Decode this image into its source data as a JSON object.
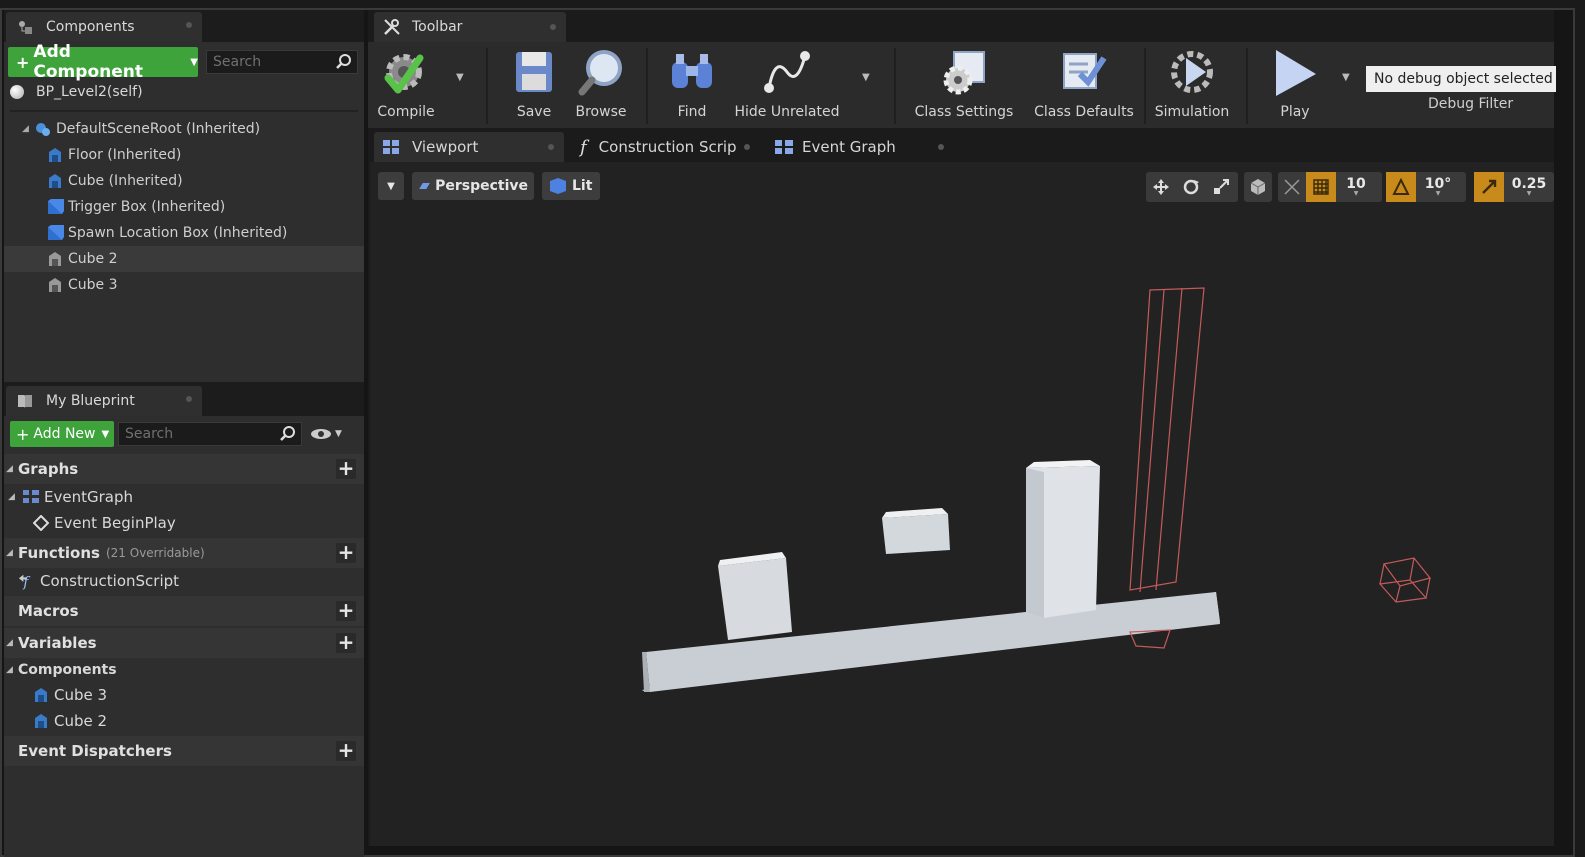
{
  "components_panel": {
    "tab_label": "Components",
    "add_button": "Add Component",
    "search_placeholder": "Search",
    "self_item": "BP_Level2(self)",
    "tree": [
      {
        "label": "DefaultSceneRoot (Inherited)"
      },
      {
        "label": "Floor (Inherited)"
      },
      {
        "label": "Cube (Inherited)"
      },
      {
        "label": "Trigger Box (Inherited)"
      },
      {
        "label": "Spawn Location Box (Inherited)"
      },
      {
        "label": "Cube 2"
      },
      {
        "label": "Cube 3"
      }
    ]
  },
  "my_blueprint": {
    "tab_label": "My Blueprint",
    "add_button": "Add New",
    "search_placeholder": "Search",
    "graphs": {
      "label": "Graphs",
      "items": [
        "EventGraph",
        "Event BeginPlay"
      ]
    },
    "functions": {
      "label": "Functions",
      "sub": "(21 Overridable)",
      "items": [
        "ConstructionScript"
      ]
    },
    "macros": {
      "label": "Macros"
    },
    "variables": {
      "label": "Variables"
    },
    "components": {
      "label": "Components",
      "items": [
        "Cube 3",
        "Cube 2"
      ]
    },
    "dispatchers": {
      "label": "Event Dispatchers"
    }
  },
  "toolbar": {
    "tab_label": "Toolbar",
    "buttons": {
      "compile": "Compile",
      "save": "Save",
      "browse": "Browse",
      "find": "Find",
      "hide_unrelated": "Hide Unrelated",
      "class_settings": "Class Settings",
      "class_defaults": "Class Defaults",
      "simulation": "Simulation",
      "play": "Play"
    },
    "debug_select": "No debug object selected",
    "debug_label": "Debug Filter"
  },
  "editor_tabs": [
    "Viewport",
    "Construction Scrip",
    "Event Graph"
  ],
  "viewport": {
    "perspective": "Perspective",
    "lit": "Lit",
    "grid_snap": "10",
    "rotation_snap": "10°",
    "scale_snap": "0.25"
  },
  "colors": {
    "accent_green": "#3ea33b",
    "snap_orange": "#c98a1c"
  }
}
